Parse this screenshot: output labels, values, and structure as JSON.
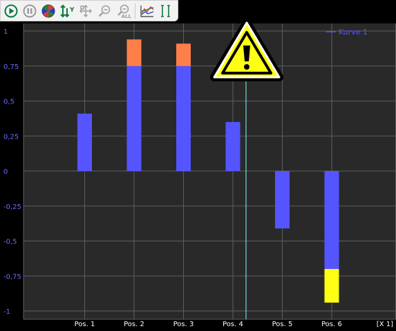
{
  "toolbar": {
    "buttons": [
      {
        "name": "play-icon",
        "semantic": "start"
      },
      {
        "name": "pause-icon",
        "semantic": "pause"
      },
      {
        "name": "color-wheel-icon",
        "semantic": "colors"
      },
      {
        "name": "y-scale-arrows-icon",
        "semantic": "y-axis scaling",
        "text": "Y"
      },
      {
        "name": "move-cross-icon",
        "semantic": "pan"
      },
      {
        "name": "zoom-out-icon",
        "semantic": "zoom out"
      },
      {
        "name": "zoom-all-icon",
        "semantic": "zoom all",
        "text": "ALL"
      },
      {
        "name": "chart-lines-icon",
        "semantic": "chart view"
      },
      {
        "name": "cursor-icon",
        "semantic": "cursor"
      }
    ]
  },
  "chart_data": {
    "type": "bar",
    "categories": [
      "Pos. 1",
      "Pos. 2",
      "Pos. 3",
      "Pos. 4",
      "Pos. 5",
      "Pos. 6"
    ],
    "x_unit_label": "[X 1]",
    "y_tick_labels": [
      "1",
      "0,75",
      "0,5",
      "0,25",
      "0",
      "-0,25",
      "-0,5",
      "-0,75",
      "-1"
    ],
    "y_ticks": [
      1,
      0.75,
      0.5,
      0.25,
      0,
      -0.25,
      -0.5,
      -0.75,
      -1
    ],
    "ylim": [
      -1,
      1
    ],
    "series": [
      {
        "name": "Kurve 1",
        "values": [
          0.41,
          0.94,
          0.91,
          0.35,
          -0.41,
          -0.94
        ]
      }
    ],
    "threshold_bands": [
      {
        "range": [
          0.75,
          1.0
        ],
        "color": "#ff7f4a"
      },
      {
        "range": [
          -1.0,
          -0.7
        ],
        "color": "#ffff14"
      }
    ],
    "cursor_x_after_category": 4,
    "grid": true,
    "legend_position": "top-right",
    "colors": {
      "bar": "#5555ff",
      "background": "#292929",
      "grid": "#5e5e5e",
      "axis_text": "#6b6bff",
      "x_text": "#ffffff",
      "cursor_line": "#7ffff4",
      "warning_fill": "#ffff14"
    },
    "warning_icon": "warning-triangle-icon"
  }
}
